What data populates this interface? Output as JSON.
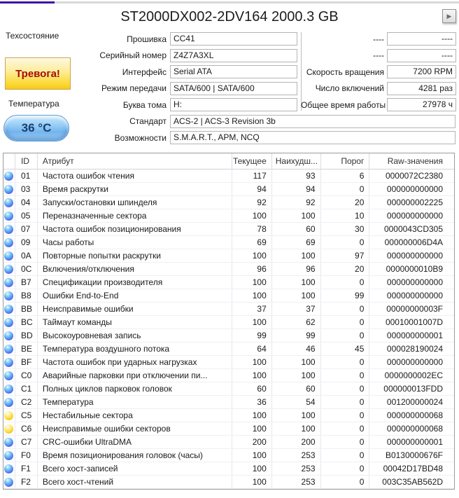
{
  "window": {
    "drive_title": "ST2000DX002-2DV164 2000.3 GB",
    "next_button_icon": "▶"
  },
  "health": {
    "section_label": "Техсостояние",
    "status_text": "Тревога!",
    "temperature_label": "Температура",
    "temperature_value": "36 °C"
  },
  "drive_info_left": {
    "rows": [
      {
        "label": "Прошивка",
        "value": "CC41",
        "box_class": "narrow"
      },
      {
        "label": "Серийный номер",
        "value": "Z4Z7A3XL",
        "box_class": "narrow"
      },
      {
        "label": "Интерфейс",
        "value": "Serial ATA",
        "box_class": "narrow"
      },
      {
        "label": "Режим передачи",
        "value": "SATA/600 | SATA/600",
        "box_class": "narrow"
      },
      {
        "label": "Буква тома",
        "value": "H:",
        "box_class": "narrow"
      },
      {
        "label": "Стандарт",
        "value": "ACS-2 | ACS-3 Revision 3b",
        "box_class": "wide"
      },
      {
        "label": "Возможности",
        "value": "S.M.A.R.T., APM, NCQ",
        "box_class": "wide"
      }
    ]
  },
  "drive_info_right": {
    "rows": [
      {
        "label": "----",
        "value": "----"
      },
      {
        "label": "----",
        "value": "----"
      },
      {
        "label": "Скорость вращения",
        "value": "7200 RPM"
      },
      {
        "label": "Число включений",
        "value": "4281 раз"
      },
      {
        "label": "Общее время работы",
        "value": "27978 ч"
      }
    ]
  },
  "smart_table": {
    "headers": {
      "id": "ID",
      "attribute": "Атрибут",
      "current": "Текущее",
      "worst": "Наихудш...",
      "threshold": "Порог",
      "raw": "Raw-значения"
    },
    "rows": [
      {
        "status": "blue",
        "id": "01",
        "attribute": "Частота ошибок чтения",
        "current": "117",
        "worst": "93",
        "threshold": "6",
        "raw": "0000072C2380"
      },
      {
        "status": "blue",
        "id": "03",
        "attribute": "Время раскрутки",
        "current": "94",
        "worst": "94",
        "threshold": "0",
        "raw": "000000000000"
      },
      {
        "status": "blue",
        "id": "04",
        "attribute": "Запуски/остановки шпинделя",
        "current": "92",
        "worst": "92",
        "threshold": "20",
        "raw": "000000002225"
      },
      {
        "status": "blue",
        "id": "05",
        "attribute": "Переназначенные сектора",
        "current": "100",
        "worst": "100",
        "threshold": "10",
        "raw": "000000000000"
      },
      {
        "status": "blue",
        "id": "07",
        "attribute": "Частота ошибок позиционирования",
        "current": "78",
        "worst": "60",
        "threshold": "30",
        "raw": "0000043CD305"
      },
      {
        "status": "blue",
        "id": "09",
        "attribute": "Часы работы",
        "current": "69",
        "worst": "69",
        "threshold": "0",
        "raw": "000000006D4A"
      },
      {
        "status": "blue",
        "id": "0A",
        "attribute": "Повторные попытки раскрутки",
        "current": "100",
        "worst": "100",
        "threshold": "97",
        "raw": "000000000000"
      },
      {
        "status": "blue",
        "id": "0C",
        "attribute": "Включения/отключения",
        "current": "96",
        "worst": "96",
        "threshold": "20",
        "raw": "0000000010B9"
      },
      {
        "status": "blue",
        "id": "B7",
        "attribute": "Спецификации производителя",
        "current": "100",
        "worst": "100",
        "threshold": "0",
        "raw": "000000000000"
      },
      {
        "status": "blue",
        "id": "B8",
        "attribute": "Ошибки End-to-End",
        "current": "100",
        "worst": "100",
        "threshold": "99",
        "raw": "000000000000"
      },
      {
        "status": "blue",
        "id": "BB",
        "attribute": "Неисправимые ошибки",
        "current": "37",
        "worst": "37",
        "threshold": "0",
        "raw": "00000000003F"
      },
      {
        "status": "blue",
        "id": "BC",
        "attribute": "Таймаут команды",
        "current": "100",
        "worst": "62",
        "threshold": "0",
        "raw": "00010001007D"
      },
      {
        "status": "blue",
        "id": "BD",
        "attribute": "Высокоуровневая запись",
        "current": "99",
        "worst": "99",
        "threshold": "0",
        "raw": "000000000001"
      },
      {
        "status": "blue",
        "id": "BE",
        "attribute": "Температура воздушного потока",
        "current": "64",
        "worst": "46",
        "threshold": "45",
        "raw": "000028190024"
      },
      {
        "status": "blue",
        "id": "BF",
        "attribute": "Частота ошибок при ударных нагрузках",
        "current": "100",
        "worst": "100",
        "threshold": "0",
        "raw": "000000000000"
      },
      {
        "status": "blue",
        "id": "C0",
        "attribute": "Аварийные парковки при отключении пи...",
        "current": "100",
        "worst": "100",
        "threshold": "0",
        "raw": "0000000002EC"
      },
      {
        "status": "blue",
        "id": "C1",
        "attribute": "Полных циклов парковок головок",
        "current": "60",
        "worst": "60",
        "threshold": "0",
        "raw": "000000013FDD"
      },
      {
        "status": "blue",
        "id": "C2",
        "attribute": "Температура",
        "current": "36",
        "worst": "54",
        "threshold": "0",
        "raw": "001200000024"
      },
      {
        "status": "yellow",
        "id": "C5",
        "attribute": "Нестабильные сектора",
        "current": "100",
        "worst": "100",
        "threshold": "0",
        "raw": "000000000068"
      },
      {
        "status": "yellow",
        "id": "C6",
        "attribute": "Неисправимые ошибки секторов",
        "current": "100",
        "worst": "100",
        "threshold": "0",
        "raw": "000000000068"
      },
      {
        "status": "blue",
        "id": "C7",
        "attribute": "CRC-ошибки UltraDMA",
        "current": "200",
        "worst": "200",
        "threshold": "0",
        "raw": "000000000001"
      },
      {
        "status": "blue",
        "id": "F0",
        "attribute": "Время позиционирования головок (часы)",
        "current": "100",
        "worst": "253",
        "threshold": "0",
        "raw": "B0130000676F"
      },
      {
        "status": "blue",
        "id": "F1",
        "attribute": "Всего хост-записей",
        "current": "100",
        "worst": "253",
        "threshold": "0",
        "raw": "00042D17BD48"
      },
      {
        "status": "blue",
        "id": "F2",
        "attribute": "Всего хост-чтений",
        "current": "100",
        "worst": "253",
        "threshold": "0",
        "raw": "003C35AB562D"
      }
    ]
  },
  "colors": {
    "accent_purple": "#3c0fa6",
    "alert_text": "#a50b0b",
    "alert_bg": "#fbd830",
    "temperature_text": "#17406f",
    "temperature_bg": "#8ec6f4",
    "status_ok_blue": "#4f8fe8",
    "status_warning_yellow": "#ffd72e"
  }
}
